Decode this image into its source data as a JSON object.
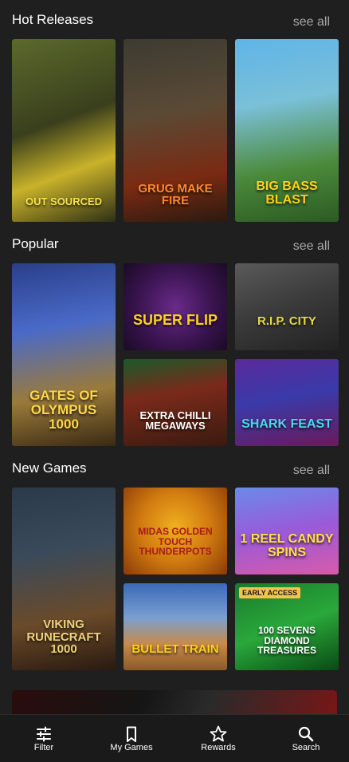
{
  "sections": [
    {
      "title": "Hot Releases",
      "see_all": "see all",
      "games": [
        {
          "title": "OUT SOURCED"
        },
        {
          "title": "GRUG MAKE FIRE"
        },
        {
          "title": "BIG BASS BLAST"
        }
      ]
    },
    {
      "title": "Popular",
      "see_all": "see all",
      "games": [
        {
          "title": "GATES OF OLYMPUS 1000"
        },
        {
          "title": "SUPER FLIP"
        },
        {
          "title": "R.I.P. CITY"
        },
        {
          "title": "EXTRA CHILLI MEGAWAYS"
        },
        {
          "title": "SHARK FEAST"
        }
      ]
    },
    {
      "title": "New Games",
      "see_all": "see all",
      "games": [
        {
          "title": "VIKING RUNECRAFT 1000"
        },
        {
          "title": "MIDAS GOLDEN TOUCH THUNDERPOTS"
        },
        {
          "title": "1 REEL CANDY SPINS"
        },
        {
          "title": "BULLET TRAIN"
        },
        {
          "title": "100 SEVENS DIAMOND TREASURES",
          "badge": "EARLY ACCESS"
        }
      ]
    }
  ],
  "nav": [
    {
      "label": "Filter",
      "icon": "filter-icon"
    },
    {
      "label": "My Games",
      "icon": "bookmark-icon"
    },
    {
      "label": "Rewards",
      "icon": "star-icon"
    },
    {
      "label": "Search",
      "icon": "search-icon"
    }
  ]
}
